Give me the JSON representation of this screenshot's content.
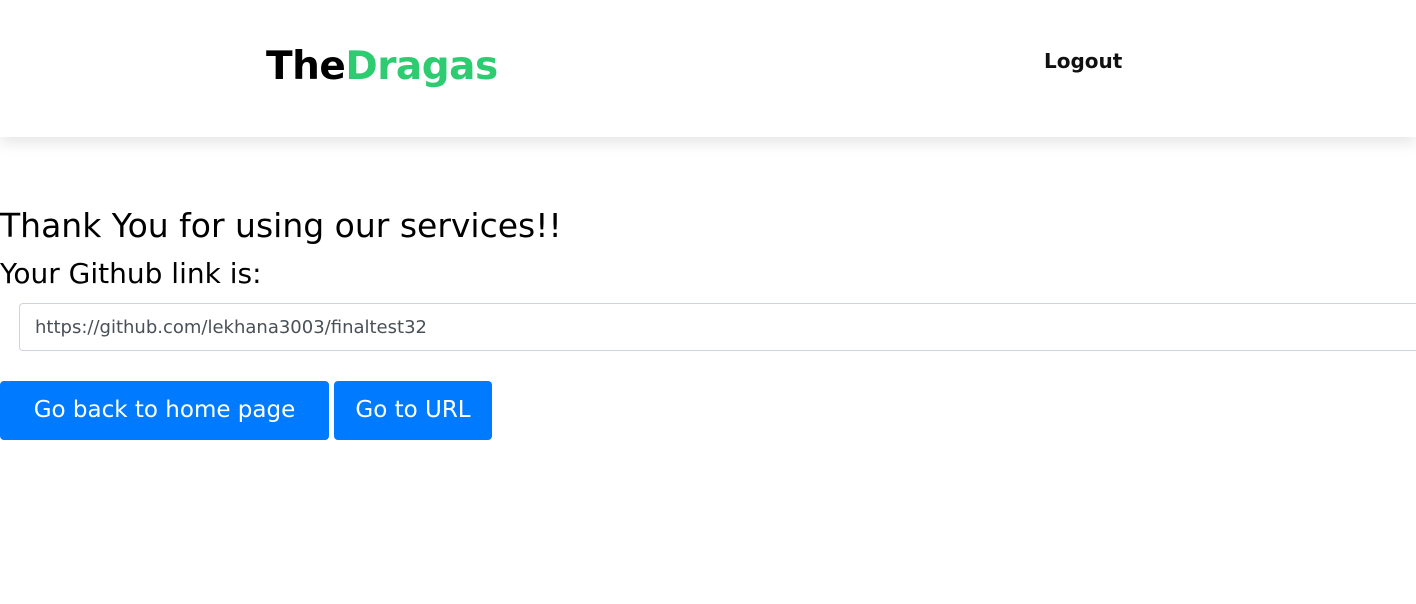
{
  "header": {
    "brand_part1": "The",
    "brand_part2": "Dragas",
    "logout_label": "Logout"
  },
  "main": {
    "heading": "Thank You for using our services!!",
    "link_label": "Your Github link is:",
    "link_value": "https://github.com/lekhana3003/finaltest32",
    "home_button_label": "Go back to home page",
    "url_button_label": "Go to URL"
  },
  "colors": {
    "brand_accent": "#2ecc71",
    "button_primary": "#007bff"
  }
}
